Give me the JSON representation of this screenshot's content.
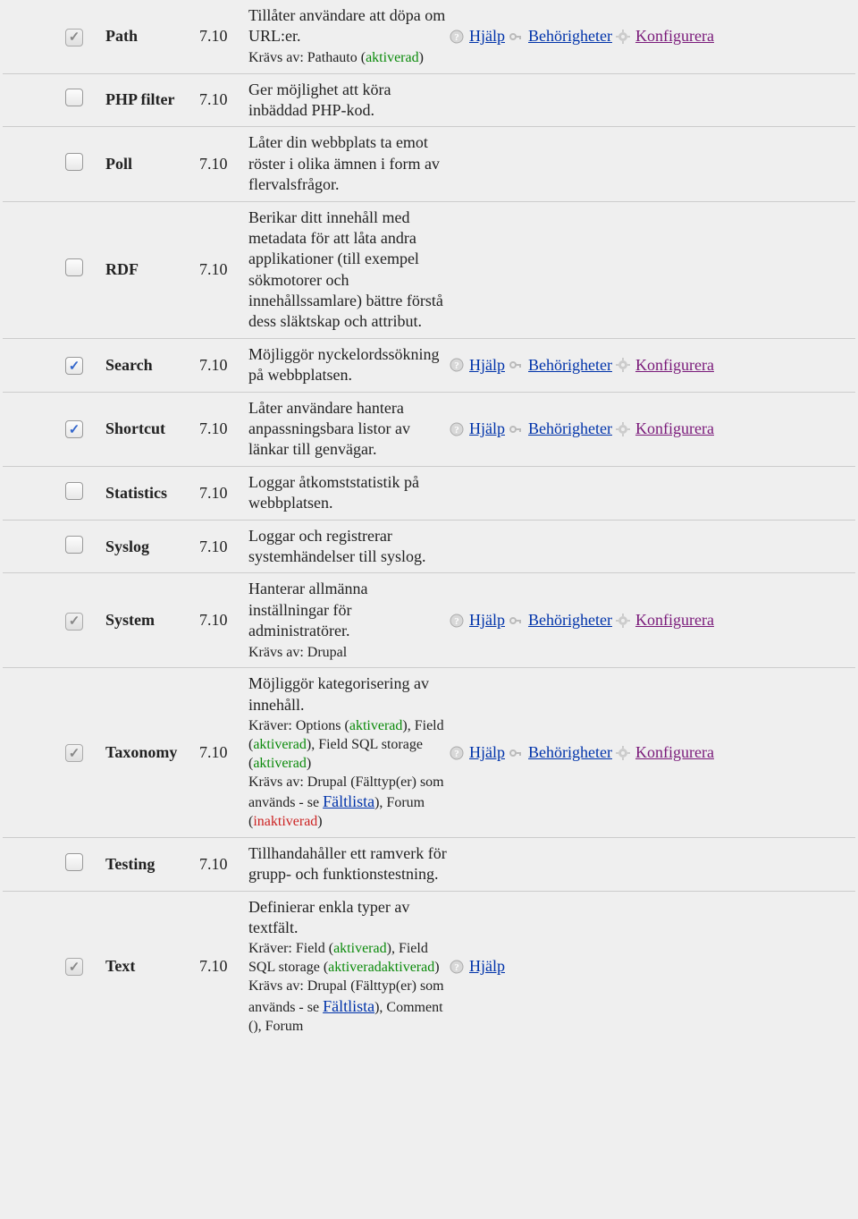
{
  "labels": {
    "help": "Hjälp",
    "permissions": "Behörigheter",
    "configure": "Konfigurera",
    "fieldlist": "Fältlista"
  },
  "status": {
    "enabled": "aktiverad",
    "disabled": "inaktiverad"
  },
  "modules": [
    {
      "id": "path",
      "checked": true,
      "locked": true,
      "name": "Path",
      "version": "7.10",
      "desc": "Tillåter användare att döpa om URL:er.",
      "sub_prefix": "Krävs av: Pathauto (",
      "sub_status": "enabled",
      "sub_suffix": ")",
      "ops": [
        "help",
        "permissions",
        "configure"
      ]
    },
    {
      "id": "phpfilter",
      "checked": false,
      "locked": false,
      "name": "PHP filter",
      "version": "7.10",
      "desc": "Ger möjlighet att köra inbäddad PHP-kod.",
      "ops": []
    },
    {
      "id": "poll",
      "checked": false,
      "locked": false,
      "name": "Poll",
      "version": "7.10",
      "desc": "Låter din webbplats ta emot röster i olika ämnen i form av flervalsfrågor.",
      "ops": []
    },
    {
      "id": "rdf",
      "checked": false,
      "locked": false,
      "name": "RDF",
      "version": "7.10",
      "desc": "Berikar ditt innehåll med metadata för att låta andra applikationer (till exempel sökmotorer och innehållssamlare) bättre förstå dess släktskap och attribut.",
      "ops": []
    },
    {
      "id": "search",
      "checked": true,
      "locked": false,
      "name": "Search",
      "version": "7.10",
      "desc": "Möjliggör nyckelordssökning på webbplatsen.",
      "ops": [
        "help",
        "permissions",
        "configure"
      ]
    },
    {
      "id": "shortcut",
      "checked": true,
      "locked": false,
      "name": "Shortcut",
      "version": "7.10",
      "desc": "Låter användare hantera anpassningsbara listor av länkar till genvägar.",
      "ops": [
        "help",
        "permissions",
        "configure"
      ]
    },
    {
      "id": "statistics",
      "checked": false,
      "locked": false,
      "name": "Statistics",
      "version": "7.10",
      "desc": "Loggar åtkomststatistik på webbplatsen.",
      "ops": []
    },
    {
      "id": "syslog",
      "checked": false,
      "locked": false,
      "name": "Syslog",
      "version": "7.10",
      "desc": "Loggar och registrerar systemhändelser till syslog.",
      "ops": []
    },
    {
      "id": "system",
      "checked": true,
      "locked": true,
      "name": "System",
      "version": "7.10",
      "desc": "Hanterar allmänna inställningar för administratörer.",
      "sub_plain": "Krävs av: Drupal",
      "ops": [
        "help",
        "permissions",
        "configure"
      ]
    },
    {
      "id": "taxonomy",
      "checked": true,
      "locked": true,
      "name": "Taxonomy",
      "version": "7.10",
      "desc": "Möjliggör kategorisering av innehåll.",
      "sub_complex": {
        "p1": "Kräver: Options (",
        "s1": "enabled",
        "p2": "), Field (",
        "s2": "enabled",
        "p3": "), Field SQL storage (",
        "s3": "enabled",
        "p4": ")",
        "p5": "Krävs av: Drupal (Fälttyp(er) som används - se ",
        "link": "fieldlist",
        "p6": "), Forum (",
        "s4": "disabled",
        "p7": ")"
      },
      "ops": [
        "help",
        "permissions",
        "configure"
      ]
    },
    {
      "id": "testing",
      "checked": false,
      "locked": false,
      "name": "Testing",
      "version": "7.10",
      "desc": "Tillhandahåller ett ramverk för grupp- och funktionstestning.",
      "ops": []
    },
    {
      "id": "text",
      "checked": true,
      "locked": true,
      "name": "Text",
      "version": "7.10",
      "desc": "Definierar enkla typer av textfält.",
      "sub_complex": {
        "p1": "Kräver: Field (",
        "s1": "enabled",
        "p2": "), Field SQL storage (",
        "s3": "enabled",
        "p4": ")",
        "p5": "Krävs av: Drupal (Fälttyp(er) som används - se ",
        "link": "fieldlist",
        "p6": "), Comment (",
        "s2": "enabled",
        "p7b": "), Forum"
      },
      "ops": [
        "help"
      ],
      "noborder": true
    }
  ]
}
